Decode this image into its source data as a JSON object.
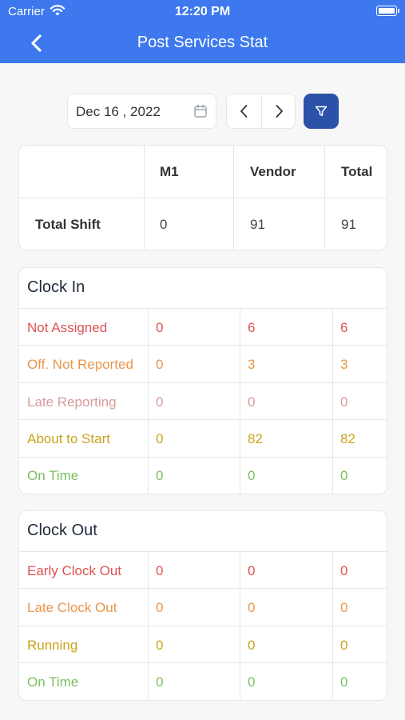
{
  "status_bar": {
    "carrier": "Carrier",
    "time": "12:20 PM"
  },
  "nav": {
    "title": "Post Services Stat"
  },
  "filters": {
    "date": "Dec 16 , 2022"
  },
  "colors": {
    "primary": "#3d78ee",
    "filter_button": "#2b52a8",
    "red": "#dd5252",
    "orange": "#e9954c",
    "pink": "#d99a9a",
    "gold": "#c9a41b",
    "green": "#7ac060"
  },
  "summary": {
    "columns": [
      "M1",
      "Vendor",
      "Total"
    ],
    "row": {
      "label": "Total Shift",
      "values": [
        "0",
        "91",
        "91"
      ]
    }
  },
  "clock_in": {
    "title": "Clock In",
    "rows": [
      {
        "label": "Not Assigned",
        "values": [
          "0",
          "6",
          "6"
        ]
      },
      {
        "label": "Off. Not Reported",
        "values": [
          "0",
          "3",
          "3"
        ]
      },
      {
        "label": "Late Reporting",
        "values": [
          "0",
          "0",
          "0"
        ]
      },
      {
        "label": "About to Start",
        "values": [
          "0",
          "82",
          "82"
        ]
      },
      {
        "label": "On Time",
        "values": [
          "0",
          "0",
          "0"
        ]
      }
    ]
  },
  "clock_out": {
    "title": "Clock Out",
    "rows": [
      {
        "label": "Early Clock Out",
        "values": [
          "0",
          "0",
          "0"
        ]
      },
      {
        "label": "Late Clock Out",
        "values": [
          "0",
          "0",
          "0"
        ]
      },
      {
        "label": "Running",
        "values": [
          "0",
          "0",
          "0"
        ]
      },
      {
        "label": "On Time",
        "values": [
          "0",
          "0",
          "0"
        ]
      }
    ]
  },
  "icons": {
    "back": "chevron-left-icon",
    "calendar": "calendar-icon",
    "prev": "chevron-left-icon",
    "next": "chevron-right-icon",
    "filter": "filter-icon"
  }
}
